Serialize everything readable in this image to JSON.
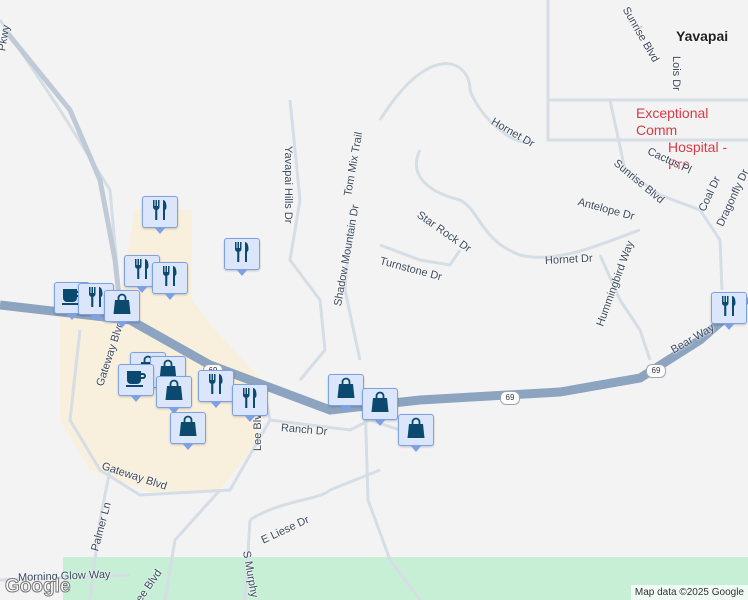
{
  "map": {
    "city_label": "Yavapai",
    "poi_label_line1": "Exceptional Comm",
    "poi_label_line2": "Hospital - Pre",
    "highway_shield": "69",
    "streets": [
      "Yavapai Hills Dr",
      "Tom Mix Trail",
      "Hornet Dr",
      "Hornet Dr",
      "Star Rock Dr",
      "Shadow Mountain Dr",
      "Turnstone Dr",
      "Antelope Dr",
      "Sunrise Blvd",
      "Sunrise Blvd",
      "Cactus Pl",
      "Coal Dr",
      "Dragonfly Dr",
      "Lois Dr",
      "Hummingbird Way",
      "Bear Way",
      "Gateway Blvd",
      "Gateway Blvd",
      "Ranch Dr",
      "Lee Blvd",
      "E Liese Dr",
      "S Murphy Way",
      "Palmer Ln",
      "Morning Glow Way",
      "Lee Blvd",
      "Pkwy"
    ],
    "attribution": "Map data ©2025 Google",
    "logo": "Google",
    "colors": {
      "highway": "#8da4c0",
      "road": "#d5dde5",
      "commercial": "#f8efdc",
      "park": "#c6efd6",
      "marker_bg": "#dbe6fb",
      "marker_icon": "#0b4a6e"
    }
  },
  "markers": [
    "restaurant",
    "restaurant",
    "restaurant",
    "restaurant",
    "cafe",
    "restaurant",
    "shopping",
    "shopping",
    "shopping",
    "cafe",
    "shopping",
    "restaurant",
    "restaurant",
    "shopping",
    "shopping",
    "shopping",
    "shopping",
    "restaurant"
  ]
}
